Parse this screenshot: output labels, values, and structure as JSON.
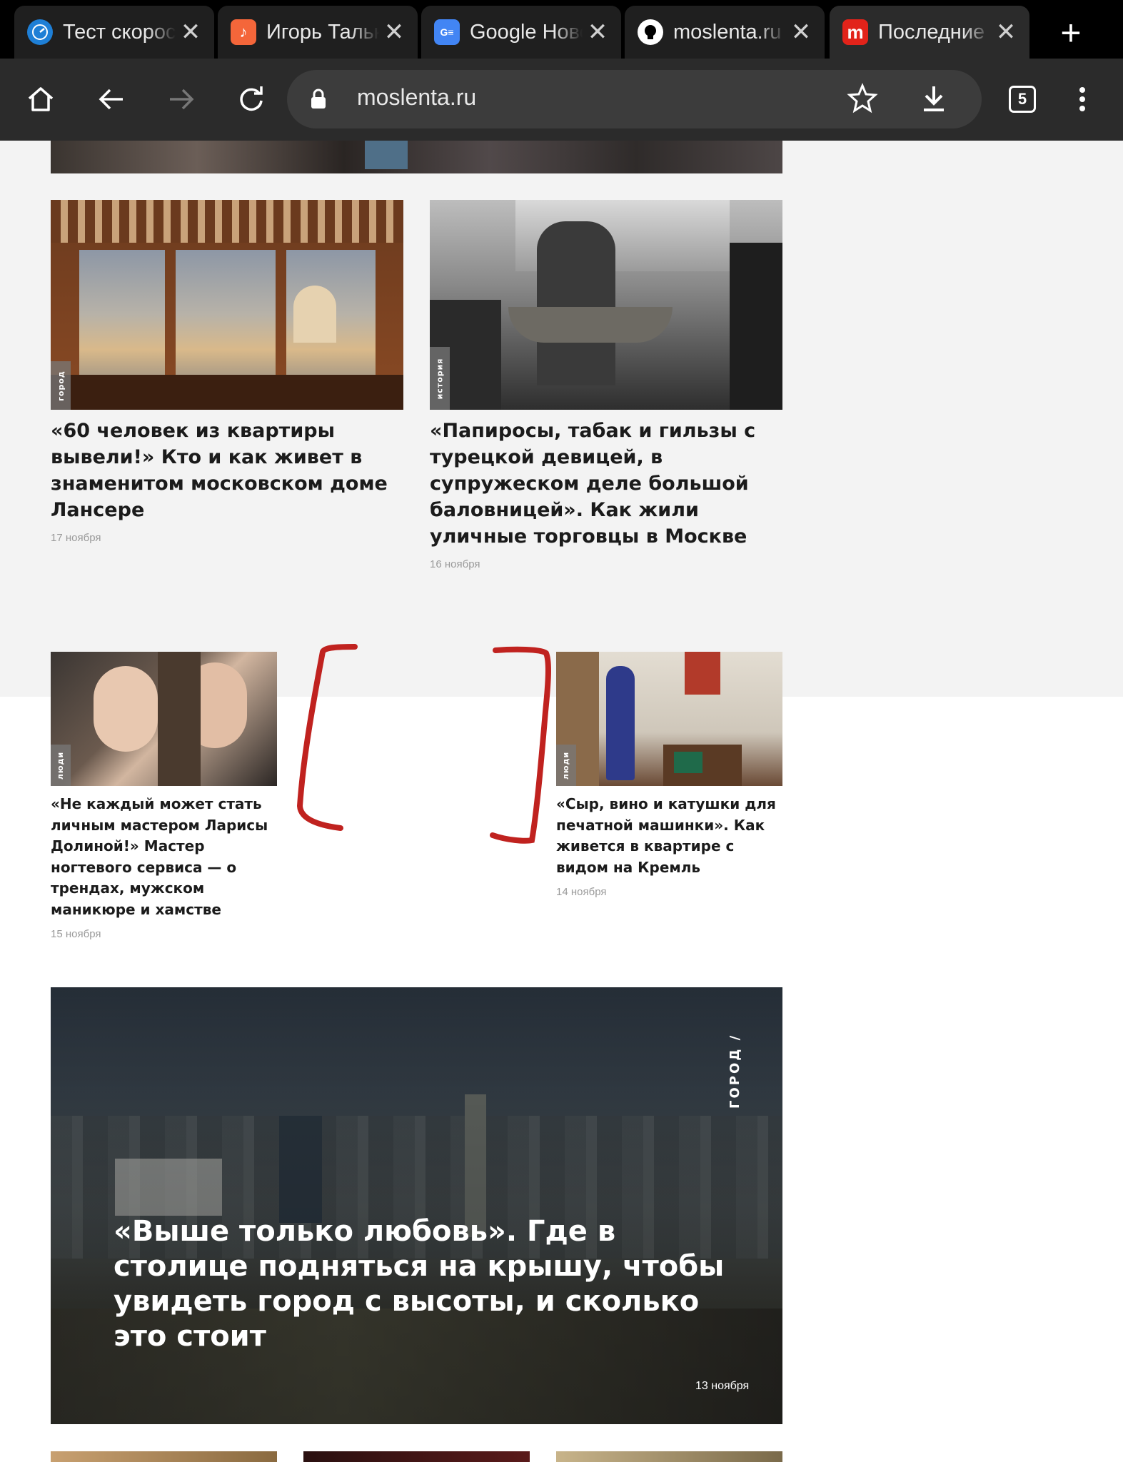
{
  "browser": {
    "tabs": [
      {
        "title": "Тест скорости",
        "favicon": "speedtest-icon",
        "active": false
      },
      {
        "title": "Игорь Тальков",
        "favicon": "music-icon",
        "active": false
      },
      {
        "title": "Google Новости",
        "favicon": "google-news-icon",
        "active": false
      },
      {
        "title": "moslenta.ru",
        "favicon": "github-icon",
        "active": false
      },
      {
        "title": "Последние новости",
        "favicon": "moslenta-icon",
        "active": true
      }
    ],
    "url": "moslenta.ru",
    "tab_count": "5",
    "colors": {
      "tabbar": "#000000",
      "toolbar": "#2b2b2b",
      "omnibox": "#3c3c3c",
      "annotation": "#c0221f"
    }
  },
  "articles": [
    {
      "rubric": "город",
      "title": "«60 человек из квартиры вывели!» Кто и как живет в знаменитом московском доме Лансере",
      "date": "17 ноября"
    },
    {
      "rubric": "история",
      "title": "«Папиросы, табак и гильзы с турецкой девицей, в супружеском деле большой баловницей». Как жили уличные торговцы в Москве",
      "date": "16 ноября"
    },
    {
      "rubric": "люди",
      "title": "«Не каждый может стать личным мастером Ларисы Долиной!» Мастер ногтевого сервиса — о трендах, мужском маникюре и хамстве",
      "date": "15 ноября"
    },
    {
      "rubric": "люди",
      "title": "«Сыр, вино и катушки для печатной машинки». Как живется в квартире с видом на Кремль",
      "date": "14 ноября"
    }
  ],
  "hero": {
    "rubric": "ГОРОД /",
    "title": "«Выше только любовь». Где в столице подняться на крышу, чтобы увидеть город с высоты, и сколько это стоит",
    "date": "13 ноября"
  }
}
